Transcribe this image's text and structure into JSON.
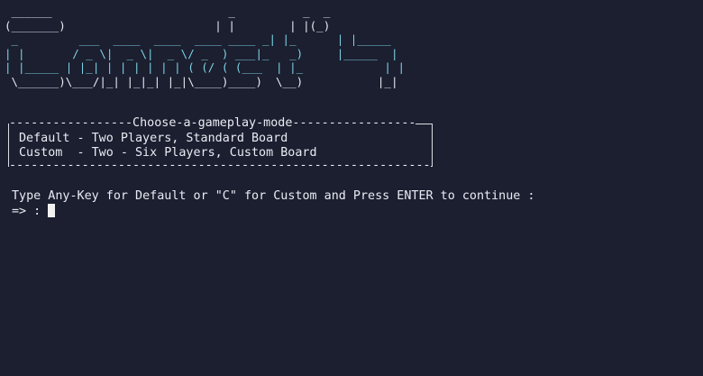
{
  "banner": {
    "row1": " ______                          _          _  _   ",
    "row2": "(_______)                      | |        | |(_)  ",
    "row3": " _         ___  ____  ____  ____ ____ _| |_      | |_____",
    "row4": "| |       / _ \\|  _ \\|  _ \\/ _  ) ___|_   _)     |_____  |",
    "row5": "| |_____ | |_| | | | | | | ( (/ ( (___  | |_            | |",
    "row6": " \\______)\\___/|_| |_|_| |_|\\____)____)  \\__)           |_|",
    "title_text": "Connect 4"
  },
  "menu": {
    "title_rule": "-----------------Choose-a-gameplay-mode-----------------",
    "bottom_rule": "----------------------------------------------------------",
    "options": [
      {
        "label": "Default",
        "separator": " - ",
        "description": "Two Players, Standard Board"
      },
      {
        "label": "Custom ",
        "separator": " - ",
        "description": "Two - Six Players, Custom Board"
      }
    ]
  },
  "prompt": {
    "instruction": "Type Any-Key for Default or \"C\" for Custom and Press ENTER to continue :",
    "input_prefix": "=> :",
    "input_value": ""
  }
}
